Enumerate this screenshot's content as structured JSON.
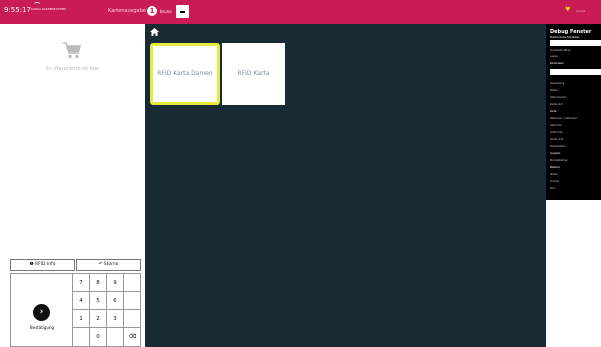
{
  "header": {
    "clock": "9:55:17",
    "brand": "KASSA KASSENSYSTEM",
    "screen_title": "Kartenausgabe",
    "user_badge": "1",
    "user_name": "bruno",
    "corner_text": "kunde"
  },
  "cart": {
    "empty_text": "Ihr Warenkorb ist leer"
  },
  "actions": {
    "info_label": "RFID Info",
    "storno_label": "Storno"
  },
  "keypad": {
    "enter_label": "Bestätigung",
    "keys": [
      "7",
      "8",
      "9",
      "4",
      "5",
      "6",
      "1",
      "2",
      "3",
      "0"
    ]
  },
  "tiles": [
    {
      "label": "RFID Karta Damen"
    },
    {
      "label": "RFID Karta"
    }
  ],
  "debug": {
    "title": "Debug Fenster",
    "lines": [
      "Elektronische Schublade",
      "Schublade öffnen",
      "Leeren",
      "Kartenleser",
      "Auswertung",
      "Weiter",
      "Saldo löschen",
      "Karten-Init",
      "Karte",
      "Abbuchen / Aufbuchen",
      "Abbuchen",
      "Aufbuchen",
      "Karten-Info",
      "Kartenstatus",
      "Ausgabe",
      "Mindestbetrag",
      "Bestand",
      "Status",
      "Drucker",
      "Test"
    ],
    "colors": {
      "heading": "#ffffff",
      "item": "#bfc6cc"
    }
  },
  "colors": {
    "topbar": "#c91b54",
    "main_bg": "#182a34",
    "highlight": "#e6ec3e",
    "tile_text": "#7a8ea0"
  }
}
